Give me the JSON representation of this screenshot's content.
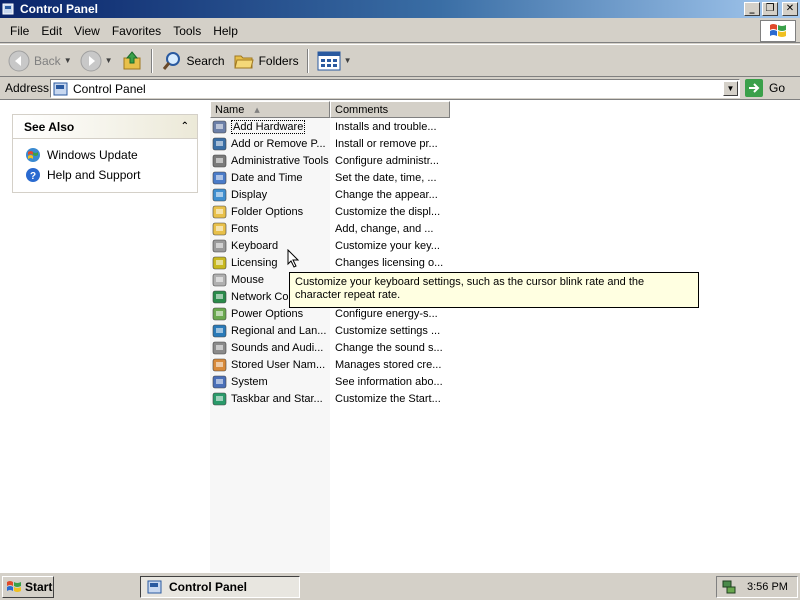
{
  "window": {
    "title": "Control Panel"
  },
  "menu": [
    {
      "label": "File",
      "key": "F",
      "rest": "ile"
    },
    {
      "label": "Edit",
      "key": "E",
      "rest": "dit"
    },
    {
      "label": "View",
      "key": "V",
      "rest": "iew"
    },
    {
      "label": "Favorites",
      "key": "",
      "pre": "F",
      "key2": "a",
      "rest": "vorites"
    },
    {
      "label": "Tools",
      "key": "T",
      "rest": "ools"
    },
    {
      "label": "Help",
      "key": "H",
      "rest": "elp"
    }
  ],
  "menu_labels": {
    "file": "File",
    "edit": "Edit",
    "view": "View",
    "favorites": "Favorites",
    "tools": "Tools",
    "help": "Help"
  },
  "toolbar": {
    "back_label": "Back",
    "search_label": "Search",
    "folders_label": "Folders"
  },
  "address": {
    "label": "Address",
    "value": "Control Panel",
    "go_label": "Go"
  },
  "see_also": {
    "title": "See Also",
    "links": [
      {
        "label": "Windows Update",
        "icon": "windows-update-icon"
      },
      {
        "label": "Help and Support",
        "icon": "help-icon"
      }
    ]
  },
  "list": {
    "columns": {
      "name": "Name",
      "comments": "Comments"
    },
    "items": [
      {
        "name": "Add Hardware",
        "comment": "Installs and trouble...",
        "icon": "add-hardware-icon",
        "color": "#6b7fa8"
      },
      {
        "name": "Add or Remove P...",
        "comment": "Install or remove pr...",
        "icon": "add-remove-programs-icon",
        "color": "#3a6ea5"
      },
      {
        "name": "Administrative Tools",
        "comment": "Configure administr...",
        "icon": "administrative-tools-icon",
        "color": "#7a7a7a"
      },
      {
        "name": "Date and Time",
        "comment": "Set the date, time, ...",
        "icon": "date-time-icon",
        "color": "#4a7bc8"
      },
      {
        "name": "Display",
        "comment": "Change the appear...",
        "icon": "display-icon",
        "color": "#3f8fd0"
      },
      {
        "name": "Folder Options",
        "comment": "Customize the displ...",
        "icon": "folder-options-icon",
        "color": "#e8c04a"
      },
      {
        "name": "Fonts",
        "comment": "Add, change, and ...",
        "icon": "fonts-icon",
        "color": "#e8c04a"
      },
      {
        "name": "Keyboard",
        "comment": "Customize your key...",
        "icon": "keyboard-icon",
        "color": "#9a9a9a"
      },
      {
        "name": "Licensing",
        "comment": "Changes licensing o...",
        "icon": "licensing-icon",
        "color": "#c8b820"
      },
      {
        "name": "Mouse",
        "comment": "",
        "icon": "mouse-icon",
        "color": "#b0b0b0"
      },
      {
        "name": "Network Co",
        "comment": "",
        "icon": "network-connections-icon",
        "color": "#2a8a4a"
      },
      {
        "name": "Power Options",
        "comment": "Configure energy-s...",
        "icon": "power-options-icon",
        "color": "#6aa84f"
      },
      {
        "name": "Regional and Lan...",
        "comment": "Customize settings ...",
        "icon": "regional-language-icon",
        "color": "#2a7ab8"
      },
      {
        "name": "Sounds and Audi...",
        "comment": "Change the sound s...",
        "icon": "sounds-audio-icon",
        "color": "#8a8a8a"
      },
      {
        "name": "Stored User Nam...",
        "comment": "Manages stored cre...",
        "icon": "stored-user-names-icon",
        "color": "#d88a3a"
      },
      {
        "name": "System",
        "comment": "See information abo...",
        "icon": "system-icon",
        "color": "#4a6fb8"
      },
      {
        "name": "Taskbar and Star...",
        "comment": "Customize the Start...",
        "icon": "taskbar-start-menu-icon",
        "color": "#2a9a6a"
      }
    ]
  },
  "tooltip": {
    "text": "Customize your keyboard settings, such as the cursor blink rate and the character repeat rate."
  },
  "taskbar": {
    "start_label": "Start",
    "task_label": "Control Panel",
    "clock": "3:56 PM"
  }
}
